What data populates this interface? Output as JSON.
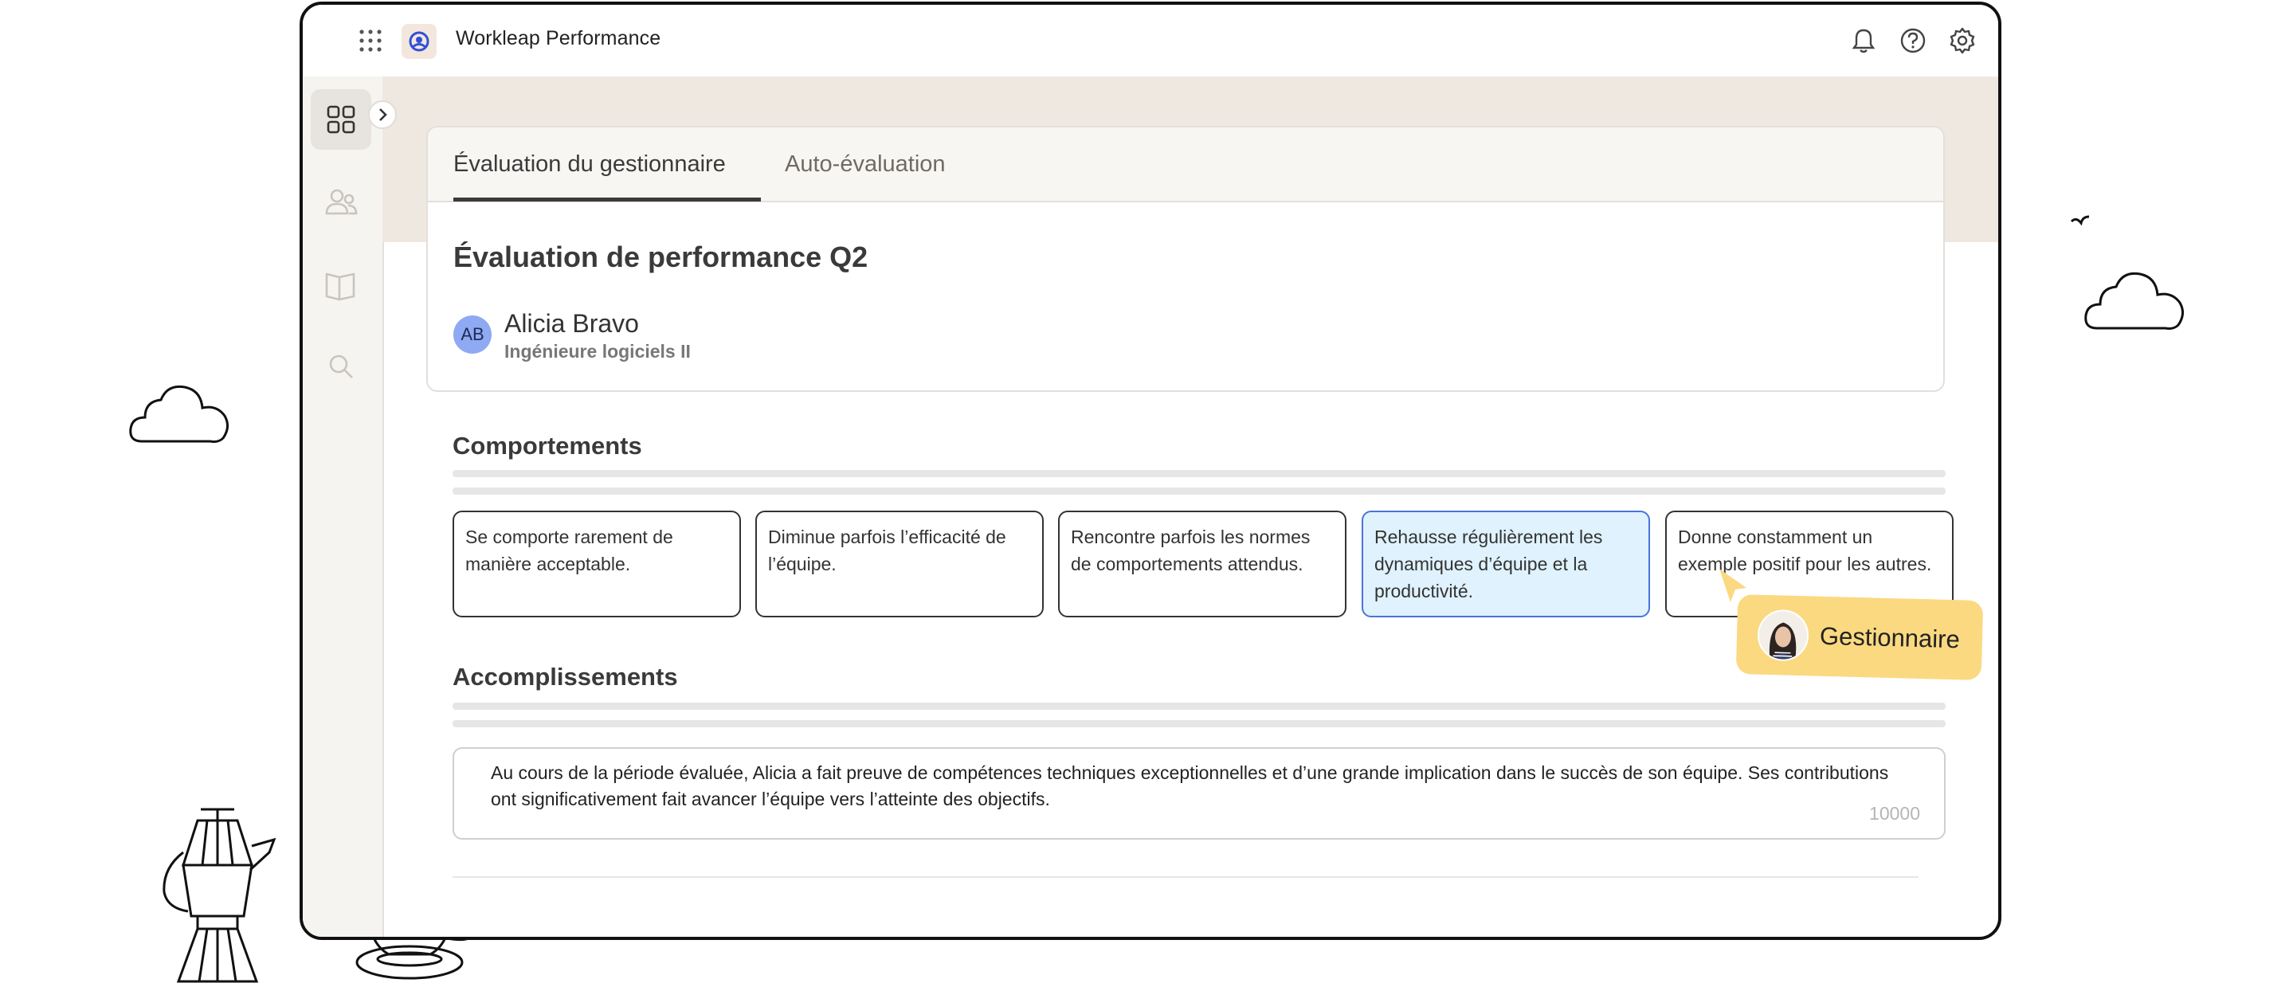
{
  "app": {
    "name": "Workleap Performance"
  },
  "tabs": [
    {
      "label": "Évaluation du gestionnaire",
      "active": true
    },
    {
      "label": "Auto-évaluation",
      "active": false
    }
  ],
  "review": {
    "title": "Évaluation de performance Q2",
    "employee": {
      "initials": "AB",
      "name": "Alicia Bravo",
      "role": "Ingénieure logiciels II"
    }
  },
  "behaviors": {
    "title": "Comportements",
    "options": [
      {
        "text": "Se comporte rarement de manière acceptable.",
        "selected": false
      },
      {
        "text": "Diminue parfois l’efficacité de l’équipe.",
        "selected": false
      },
      {
        "text": "Rencontre parfois les normes de comportements attendus.",
        "selected": false
      },
      {
        "text": "Rehausse régulièrement les dynamiques d’équipe et la productivité.",
        "selected": true
      },
      {
        "text": "Donne constamment un exemple positif pour les autres.",
        "selected": false
      }
    ],
    "selected_by_label": "Gestionnaire"
  },
  "accomplishments": {
    "title": "Accomplissements",
    "text": "Au cours de la période évaluée, Alicia a fait preuve de compétences techniques exceptionnelles et d’une grande implication dans le succès de son équipe. Ses contributions ont significativement fait avancer l’équipe vers l’atteinte des objectifs.",
    "char_count": "10000"
  },
  "icons": {
    "topbar": [
      "apps-grid-icon",
      "workleap-logo-icon",
      "bell-icon",
      "help-icon",
      "settings-icon"
    ],
    "sidebar": [
      "dashboard-icon",
      "people-icon",
      "book-icon",
      "search-icon",
      "chevron-right-icon"
    ]
  },
  "colors": {
    "accent_selected": "#dff2fd",
    "accent_border": "#4a74d9",
    "tag": "#fbd981",
    "banner": "#efe8e1"
  }
}
